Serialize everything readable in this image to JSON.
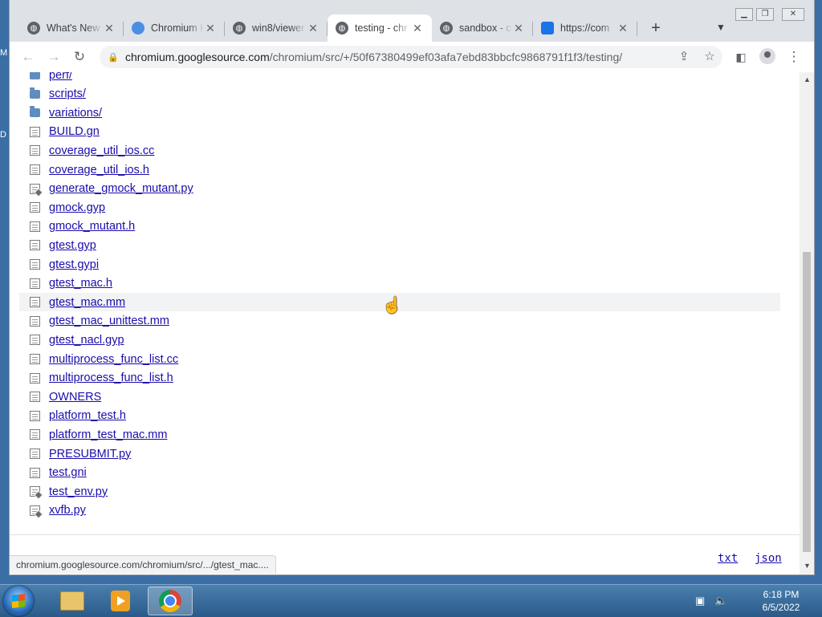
{
  "desktop": {
    "edge_letters": [
      "M",
      "D"
    ]
  },
  "tabs": [
    {
      "title": "What's New",
      "favicon": "globe-icon"
    },
    {
      "title": "Chromium H",
      "favicon": "chromium-icon"
    },
    {
      "title": "win8/viewer",
      "favicon": "globe-icon"
    },
    {
      "title": "testing - chr",
      "favicon": "globe-icon",
      "active": true
    },
    {
      "title": "sandbox - c",
      "favicon": "globe-icon"
    },
    {
      "title": "https://com",
      "favicon": "blue-square-icon"
    }
  ],
  "toolbar": {
    "url_host": "chromium.googlesource.com",
    "url_path": "/chromium/src/+/50f67380499ef03afa7ebd83bbcfc9868791f1f3/testing/"
  },
  "files": [
    {
      "name": "perf/",
      "type": "folder"
    },
    {
      "name": "scripts/",
      "type": "folder"
    },
    {
      "name": "variations/",
      "type": "folder"
    },
    {
      "name": "BUILD.gn",
      "type": "file"
    },
    {
      "name": "coverage_util_ios.cc",
      "type": "file"
    },
    {
      "name": "coverage_util_ios.h",
      "type": "file"
    },
    {
      "name": "generate_gmock_mutant.py",
      "type": "exec"
    },
    {
      "name": "gmock.gyp",
      "type": "file"
    },
    {
      "name": "gmock_mutant.h",
      "type": "file"
    },
    {
      "name": "gtest.gyp",
      "type": "file"
    },
    {
      "name": "gtest.gypi",
      "type": "file"
    },
    {
      "name": "gtest_mac.h",
      "type": "file"
    },
    {
      "name": "gtest_mac.mm",
      "type": "file",
      "hover": true
    },
    {
      "name": "gtest_mac_unittest.mm",
      "type": "file"
    },
    {
      "name": "gtest_nacl.gyp",
      "type": "file"
    },
    {
      "name": "multiprocess_func_list.cc",
      "type": "file"
    },
    {
      "name": "multiprocess_func_list.h",
      "type": "file"
    },
    {
      "name": "OWNERS",
      "type": "file"
    },
    {
      "name": "platform_test.h",
      "type": "file"
    },
    {
      "name": "platform_test_mac.mm",
      "type": "file"
    },
    {
      "name": "PRESUBMIT.py",
      "type": "file"
    },
    {
      "name": "test.gni",
      "type": "file"
    },
    {
      "name": "test_env.py",
      "type": "exec"
    },
    {
      "name": "xvfb.py",
      "type": "exec"
    }
  ],
  "footer": {
    "txt_label": "txt",
    "json_label": "json"
  },
  "status_url": "chromium.googlesource.com/chromium/src/.../gtest_mac....",
  "taskbar": {
    "apps": [
      "folder-icon",
      "media-player-icon",
      "chrome-icon"
    ],
    "time": "6:18 PM",
    "date": "6/5/2022"
  },
  "colors": {
    "link": "#1a0dab",
    "folder": "#5f8dbf",
    "taskbar": "#2a5a8a"
  }
}
